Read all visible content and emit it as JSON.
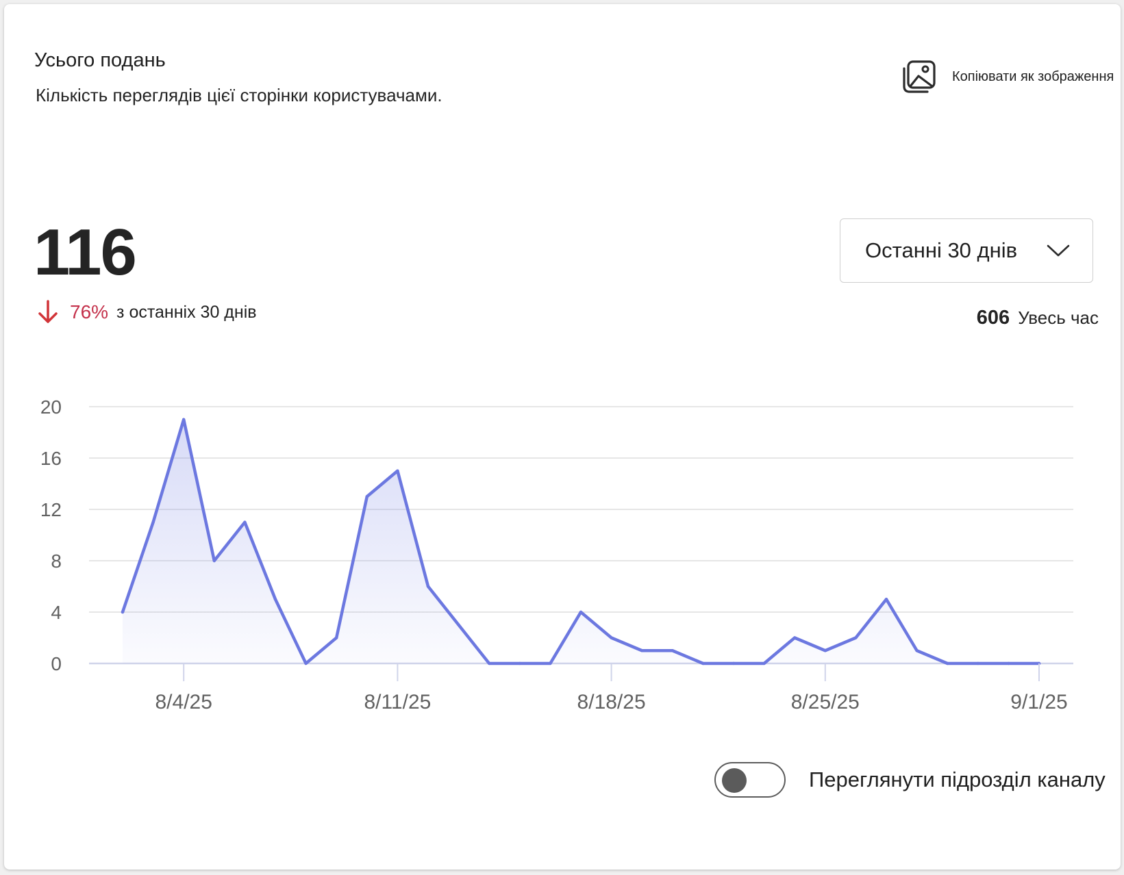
{
  "card": {
    "title": "Усього подань",
    "subtitle": "Кількість переглядів цієї сторінки користувачами.",
    "copy_label": "Копіювати як зображення",
    "copy_icon": "image-copy-icon"
  },
  "summary": {
    "total": "116",
    "change_pct": "76%",
    "change_text": "з останніх 30 днів",
    "change_direction": "down",
    "down_color": "#c4314b",
    "all_time_value": "606",
    "all_time_label": "Увесь час"
  },
  "range_select": {
    "selected": "Останні 30 днів",
    "icon": "chevron-down-icon"
  },
  "toggle": {
    "label": "Переглянути підрозділ каналу",
    "on": false
  },
  "chart_data": {
    "type": "area",
    "x": [
      "2025-08-02",
      "2025-08-03",
      "2025-08-04",
      "2025-08-05",
      "2025-08-06",
      "2025-08-07",
      "2025-08-08",
      "2025-08-09",
      "2025-08-10",
      "2025-08-11",
      "2025-08-12",
      "2025-08-13",
      "2025-08-14",
      "2025-08-15",
      "2025-08-16",
      "2025-08-17",
      "2025-08-18",
      "2025-08-19",
      "2025-08-20",
      "2025-08-21",
      "2025-08-22",
      "2025-08-23",
      "2025-08-24",
      "2025-08-25",
      "2025-08-26",
      "2025-08-27",
      "2025-08-28",
      "2025-08-29",
      "2025-08-30",
      "2025-08-31",
      "2025-09-01"
    ],
    "values": [
      4,
      11,
      19,
      8,
      11,
      5,
      0,
      2,
      13,
      15,
      6,
      3,
      0,
      0,
      0,
      4,
      2,
      1,
      1,
      0,
      0,
      0,
      2,
      1,
      2,
      5,
      1,
      0,
      0,
      0,
      0
    ],
    "x_ticks": [
      "8/4/25",
      "8/11/25",
      "8/18/25",
      "8/25/25",
      "9/1/25"
    ],
    "y_ticks": [
      "0",
      "4",
      "8",
      "12",
      "16",
      "20"
    ],
    "ylim": [
      0,
      20
    ],
    "grid": true,
    "color": "#6c78e0"
  }
}
